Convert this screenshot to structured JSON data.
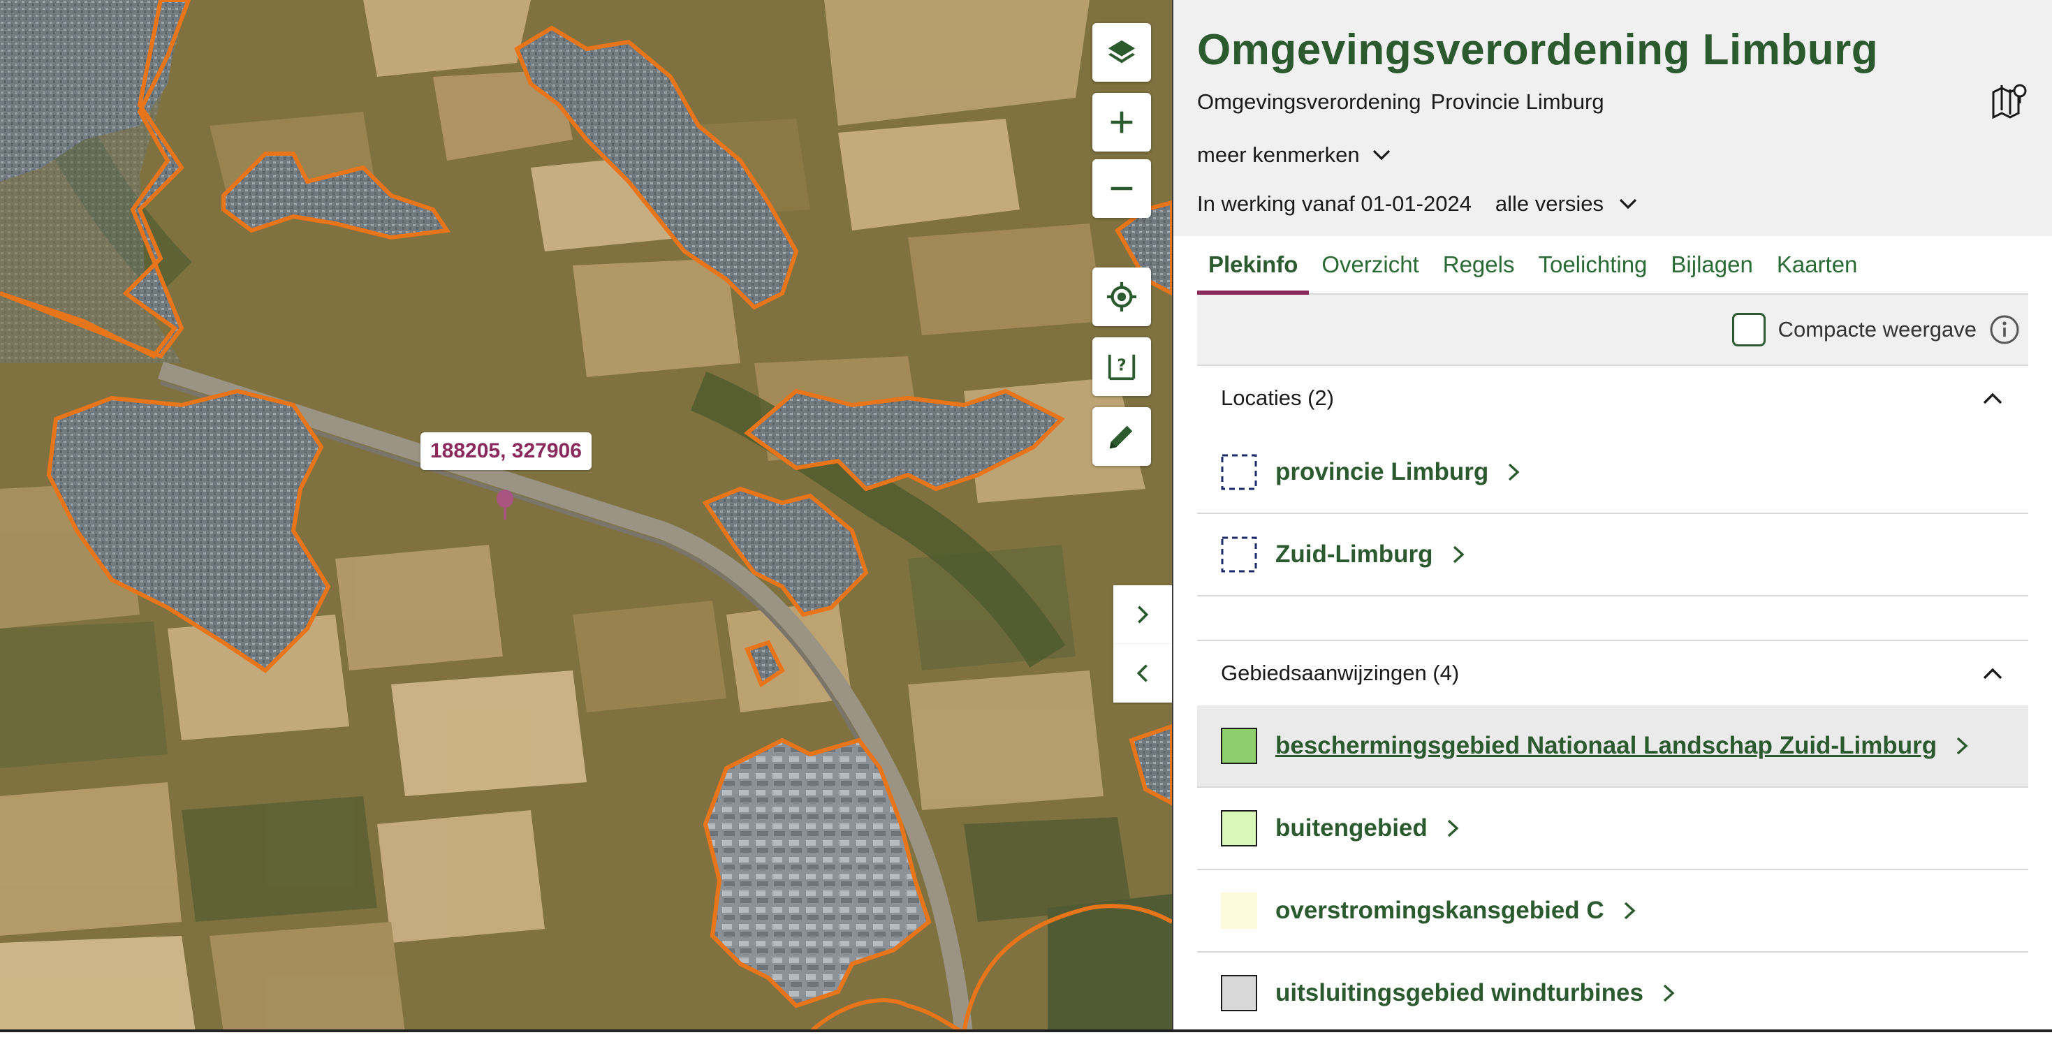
{
  "map": {
    "coordinate_label": "188205, 327906",
    "controls": {
      "layers_icon": "layers-icon",
      "zoom_in_icon": "plus-icon",
      "zoom_out_icon": "minus-icon",
      "locate_icon": "crosshair-icon",
      "measure_icon": "measure-question-icon",
      "draw_icon": "pencil-icon",
      "expand_icon": "chevron-right-icon",
      "collapse_icon": "chevron-left-icon"
    },
    "colors": {
      "boundary": "#e8751a",
      "marker": "#b0508a"
    }
  },
  "panel": {
    "title": "Omgevingsverordening Limburg",
    "doc_type": "Omgevingsverordening",
    "authority": "Provincie Limburg",
    "meer_kenmerken": "meer kenmerken",
    "in_werking": "In werking vanaf 01-01-2024",
    "versies": "alle versies",
    "map_icon": "map-pin-icon",
    "tabs": [
      {
        "label": "Plekinfo",
        "active": true
      },
      {
        "label": "Overzicht",
        "active": false
      },
      {
        "label": "Regels",
        "active": false
      },
      {
        "label": "Toelichting",
        "active": false
      },
      {
        "label": "Bijlagen",
        "active": false
      },
      {
        "label": "Kaarten",
        "active": false
      }
    ],
    "compact_label": "Compacte weergave",
    "locaties": {
      "heading": "Locaties (2)",
      "items": [
        {
          "label": "provincie Limburg"
        },
        {
          "label": "Zuid-Limburg"
        }
      ]
    },
    "gebiedsaanwijzingen": {
      "heading": "Gebiedsaanwijzingen (4)",
      "items": [
        {
          "label": "beschermingsgebied Nationaal Landschap Zuid-Limburg",
          "color": "#8dcf6e",
          "selected": true
        },
        {
          "label": "buitengebied",
          "color": "#d8f7b8",
          "selected": false
        },
        {
          "label": "overstromingskansgebied C",
          "color": "#fdfbdc",
          "selected": false
        },
        {
          "label": "uitsluitingsgebied windturbines",
          "color": "#d9d9d9",
          "selected": false
        }
      ]
    },
    "colors": {
      "accent": "#8a2a5c",
      "primary": "#2a5a2e"
    }
  }
}
